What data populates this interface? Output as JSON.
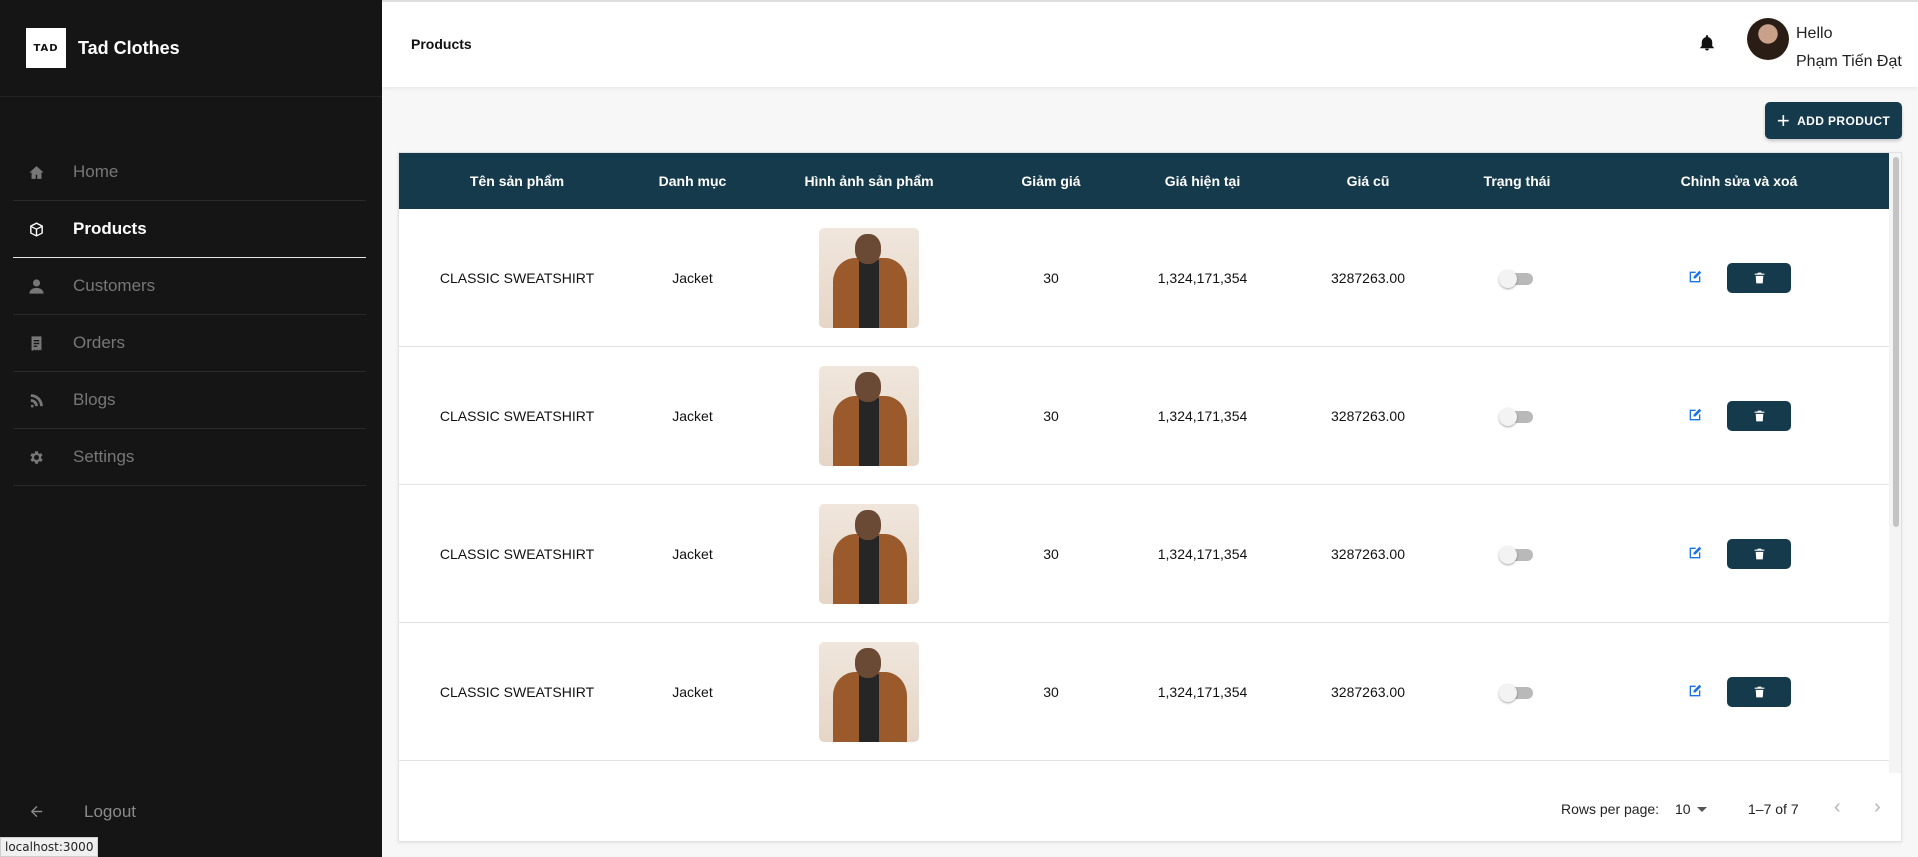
{
  "brand": {
    "logo_text": "TAD",
    "name": "Tad Clothes"
  },
  "sidebar": {
    "items": [
      {
        "label": "Home",
        "icon": "home-icon",
        "active": false
      },
      {
        "label": "Products",
        "icon": "box-icon",
        "active": true
      },
      {
        "label": "Customers",
        "icon": "user-icon",
        "active": false
      },
      {
        "label": "Orders",
        "icon": "receipt-icon",
        "active": false
      },
      {
        "label": "Blogs",
        "icon": "blog-icon",
        "active": false
      },
      {
        "label": "Settings",
        "icon": "gear-icon",
        "active": false
      }
    ],
    "logout_label": "Logout"
  },
  "status_url": "localhost:3000",
  "header": {
    "title": "Products",
    "greeting": "Hello",
    "user_name": "Phạm Tiến Đạt"
  },
  "actions": {
    "add_product_label": "ADD PRODUCT"
  },
  "table": {
    "columns": [
      "Tên sản phẩm",
      "Danh mục",
      "Hình ảnh sản phẩm",
      "Giảm giá",
      "Giá hiện tại",
      "Giá cũ",
      "Trạng thái",
      "Chỉnh sửa và xoá"
    ],
    "rows": [
      {
        "name": "CLASSIC SWEATSHIRT",
        "category": "Jacket",
        "discount": "30",
        "current_price": "1,324,171,354",
        "old_price": "3287263.00",
        "status_on": false
      },
      {
        "name": "CLASSIC SWEATSHIRT",
        "category": "Jacket",
        "discount": "30",
        "current_price": "1,324,171,354",
        "old_price": "3287263.00",
        "status_on": false
      },
      {
        "name": "CLASSIC SWEATSHIRT",
        "category": "Jacket",
        "discount": "30",
        "current_price": "1,324,171,354",
        "old_price": "3287263.00",
        "status_on": false
      },
      {
        "name": "CLASSIC SWEATSHIRT",
        "category": "Jacket",
        "discount": "30",
        "current_price": "1,324,171,354",
        "old_price": "3287263.00",
        "status_on": false
      }
    ]
  },
  "pagination": {
    "rows_per_page_label": "Rows per page:",
    "rows_per_page": "10",
    "range": "1–7 of 7"
  },
  "colors": {
    "sidebar_bg": "#151515",
    "header_accent": "#153a4c",
    "edit_icon": "#1a73e8"
  }
}
